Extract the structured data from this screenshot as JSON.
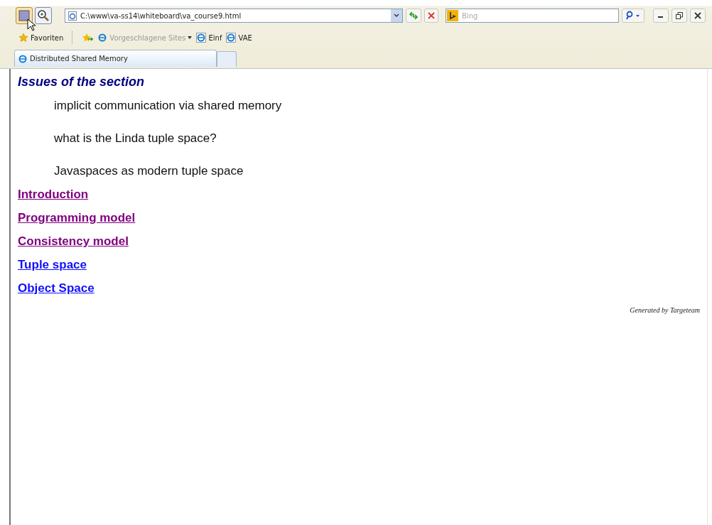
{
  "address_bar": {
    "value": "C:\\www\\va-ss14\\whiteboard\\va_course9.html"
  },
  "search": {
    "placeholder": "Bing"
  },
  "favorites_bar": {
    "favorites_label": "Favoriten",
    "items": [
      {
        "label": "Vorgeschlagene Sites",
        "kind": "dropdown"
      },
      {
        "label": "Einf",
        "kind": "link"
      },
      {
        "label": "VAE",
        "kind": "link"
      }
    ]
  },
  "tabs": [
    {
      "label": "Distributed Shared Memory",
      "selected": true
    }
  ],
  "page": {
    "heading": "Issues of the section",
    "issues": [
      "implicit communication via shared memory",
      "what is the Linda tuple space?",
      "Javaspaces as modern tuple space"
    ],
    "links": [
      {
        "label": "Introduction",
        "visited": true
      },
      {
        "label": "Programming model",
        "visited": true
      },
      {
        "label": "Consistency model",
        "visited": true
      },
      {
        "label": "Tuple space",
        "visited": false
      },
      {
        "label": "Object Space",
        "visited": false
      }
    ],
    "footer": "Generated by Targeteam"
  }
}
